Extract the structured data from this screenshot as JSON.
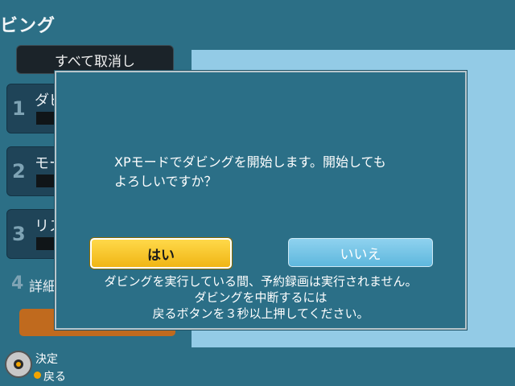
{
  "screen": {
    "title_partial": "ビング"
  },
  "background_menu": {
    "cancel_all": "すべて取消し",
    "steps": [
      {
        "num": "1",
        "label_partial": "ダビ"
      },
      {
        "num": "2",
        "label_partial": "モー"
      },
      {
        "num": "3",
        "label_partial": "リス"
      },
      {
        "num": "4",
        "label_partial": "詳細"
      }
    ]
  },
  "dialog": {
    "message_line1": "XPモードでダビングを開始します。開始しても",
    "message_line2": "よろしいですか？",
    "yes_label": "はい",
    "no_label": "いいえ",
    "note_line1": "ダビングを実行している間、予約録画は実行されません。",
    "note_line2": "ダビングを中断するには",
    "note_line3": "戻るボタンを３秒以上押してください。"
  },
  "footer": {
    "enter_label": "決定",
    "back_label": "戻る"
  },
  "colors": {
    "background": "#2c6f86",
    "yes_button": "#f0b514",
    "no_button": "#5eb7dd",
    "start_button": "#c06a1e"
  }
}
